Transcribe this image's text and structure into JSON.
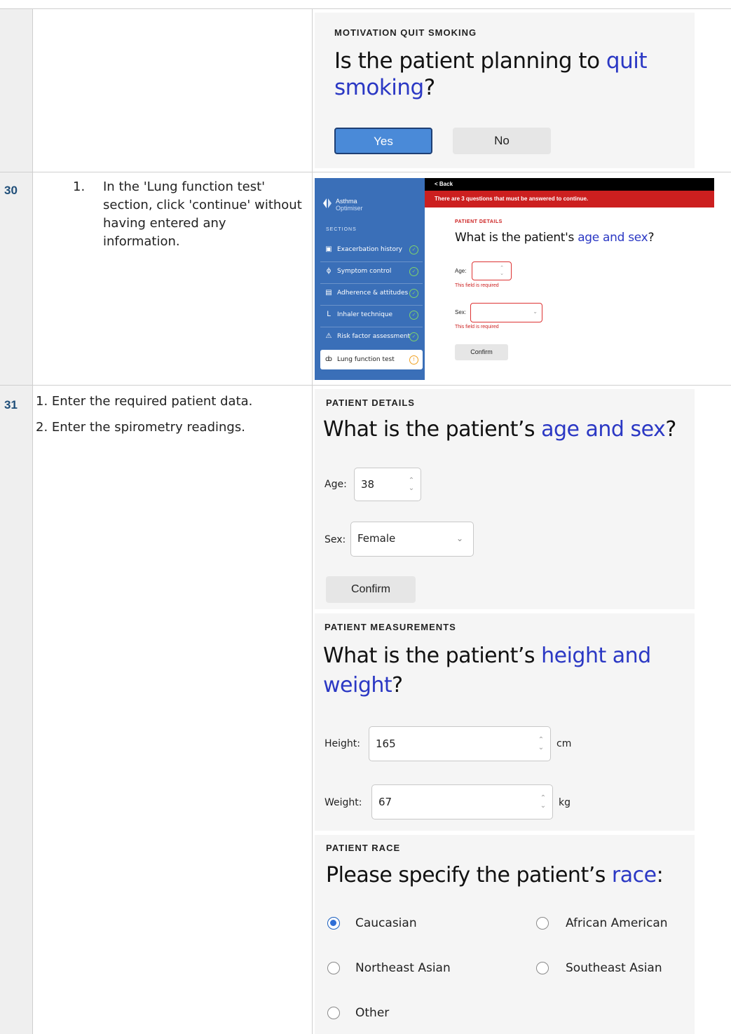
{
  "row29": {
    "eyebrow": "MOTIVATION QUIT SMOKING",
    "question_a": "Is the patient planning to ",
    "question_hl": "quit smoking",
    "question_b": "?",
    "yes": "Yes",
    "no": "No"
  },
  "row30": {
    "number": "30",
    "step_index": "1.",
    "step_text": "In the 'Lung function test' section, click 'continue' without having entered any information.",
    "app": {
      "back": "< Back",
      "error_banner": "There are 3 questions that must be answered to continue.",
      "brand_top": "Asthma",
      "brand_bottom": "Optimiser",
      "sections_label": "SECTIONS",
      "sections": [
        {
          "label": "Exacerbation history",
          "icon": "calendar-icon"
        },
        {
          "label": "Symptom control",
          "icon": "lungs-icon"
        },
        {
          "label": "Adherence & attitudes",
          "icon": "clipboard-icon"
        },
        {
          "label": "Inhaler technique",
          "icon": "inhaler-icon"
        },
        {
          "label": "Risk factor assessment",
          "icon": "warning-icon"
        },
        {
          "label": "Lung function test",
          "icon": "lungs-icon"
        }
      ],
      "eyebrow": "PATIENT DETAILS",
      "question_a": "What is the patient's ",
      "question_hl": "age and sex",
      "question_b": "?",
      "age_label": "Age:",
      "sex_label": "Sex:",
      "required_msg": "This field is required",
      "confirm": "Confirm"
    },
    "colors": {
      "sidebar": "#3a6fb8",
      "error": "#cc1f1f",
      "banner": "#000000"
    }
  },
  "row31": {
    "number": "31",
    "steps": [
      "1. Enter the required patient data.",
      "2. Enter the spirometry readings."
    ],
    "details": {
      "eyebrow": "PATIENT DETAILS",
      "question_a": "What is the patient’s ",
      "question_hl": "age and sex",
      "question_b": "?",
      "age_label": "Age:",
      "age_value": "38",
      "sex_label": "Sex:",
      "sex_value": "Female",
      "confirm": "Confirm"
    },
    "measurements": {
      "eyebrow": "PATIENT MEASUREMENTS",
      "question_a": "What is the patient’s ",
      "question_hl_1": "height and",
      "question_hl_2": "weight",
      "question_b": "?",
      "height_label": "Height:",
      "height_value": "165",
      "height_unit": "cm",
      "weight_label": "Weight:",
      "weight_value": "67",
      "weight_unit": "kg"
    },
    "race": {
      "eyebrow": "PATIENT RACE",
      "question_a": "Please specify the patient’s ",
      "question_hl": "race",
      "question_b": ":",
      "options": [
        "Caucasian",
        "African American",
        "Northeast Asian",
        "Southeast Asian",
        "Other"
      ],
      "selected": "Caucasian"
    }
  }
}
